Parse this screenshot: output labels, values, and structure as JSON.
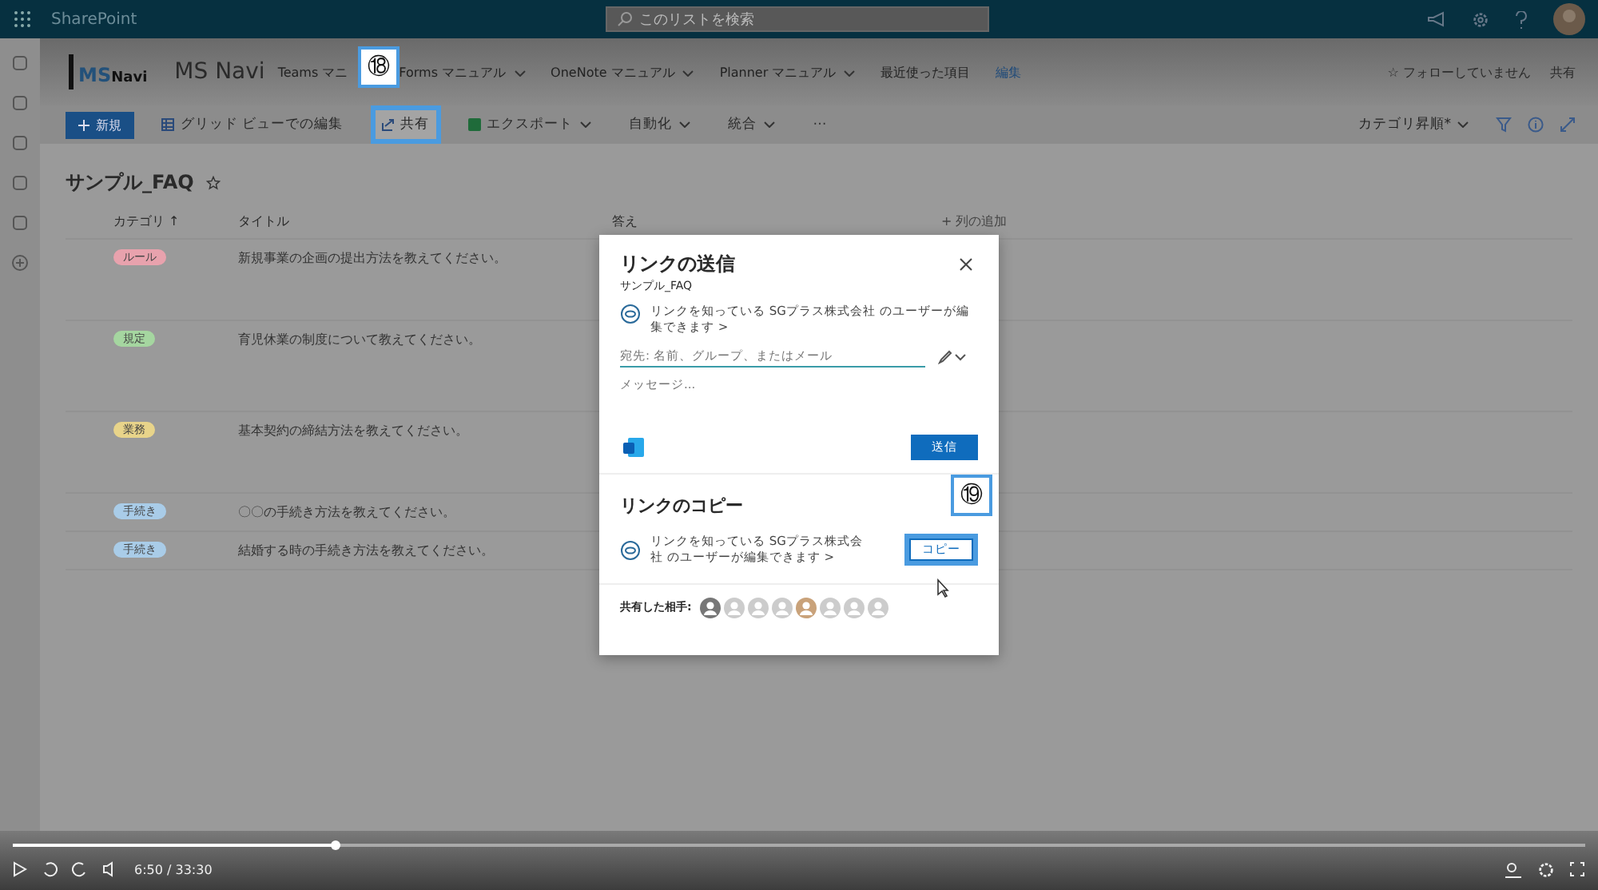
{
  "top_bar": {
    "app": "SharePoint",
    "search": {
      "placeholder": "このリストを検索"
    }
  },
  "site": {
    "name": "MS Navi",
    "logo_ms": "MS",
    "logo_navi": "Navi",
    "nav": [
      {
        "label": "Teams マニ",
        "dropdown": false
      },
      {
        "label": "Forms マニュアル",
        "dropdown": true
      },
      {
        "label": "OneNote マニュアル",
        "dropdown": true
      },
      {
        "label": "Planner マニュアル",
        "dropdown": true
      },
      {
        "label": "最近使った項目",
        "dropdown": false
      }
    ],
    "edit": "編集",
    "follow": "☆ フォローしていません",
    "share": "共有"
  },
  "command_bar": {
    "new": "新規",
    "grid": "グリッド ビューでの編集",
    "share": {
      "label": "共有",
      "highlighted": true
    },
    "export": "エクスポート",
    "automate": "自動化",
    "integrate": "統合",
    "more": "⋯",
    "view": "カテゴリ昇順*"
  },
  "list": {
    "title": "サンプル_FAQ",
    "columns": [
      "カテゴリ ↑",
      "タイトル",
      "答え"
    ],
    "add_column": "+ 列の追加",
    "rows": [
      {
        "category": "ルール",
        "color": "#e8a2ad",
        "title": "新規事業の企画の提出方法を教えてください。"
      },
      {
        "category": "規定",
        "color": "#a5d6a0",
        "title": "育児休業の制度について教えてください。"
      },
      {
        "category": "業務",
        "color": "#e8d48a",
        "title": "基本契約の締結方法を教えてください。"
      },
      {
        "category": "手続き",
        "color": "#a9cce8",
        "title": "〇〇の手続き方法を教えてください。"
      },
      {
        "category": "手続き",
        "color": "#a9cce8",
        "title": "結婚する時の手続き方法を教えてください。"
      }
    ]
  },
  "dialog": {
    "title": "リンクの送信",
    "subtitle": "サンプル_FAQ",
    "permission": "リンクを知っている SGプラス株式会社 のユーザーが編集できます >",
    "to": {
      "placeholder": "宛先: 名前、グループ、またはメール"
    },
    "message": {
      "placeholder": "メッセージ..."
    },
    "send": "送信",
    "copy_title": "リンクのコピー",
    "copy_permission": "リンクを知っている SGプラス株式会社 のユーザーが編集できます >",
    "copy": {
      "label": "コピー",
      "highlighted": true
    },
    "shared_with": "共有した相手:"
  },
  "callouts": [
    "⑱",
    "⑲"
  ],
  "player": {
    "level": 0.205,
    "time": "6:50 / 33:30"
  }
}
